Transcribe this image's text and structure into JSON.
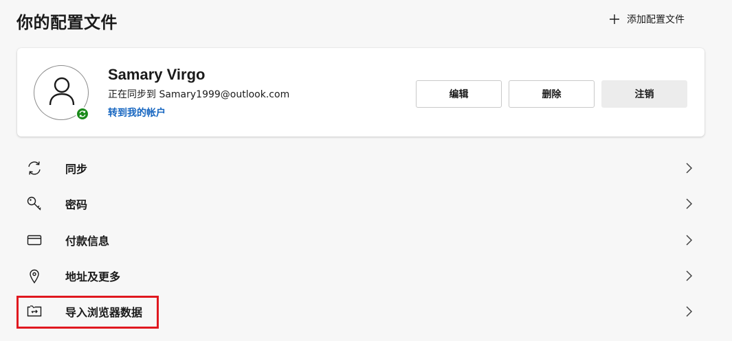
{
  "header": {
    "title": "你的配置文件",
    "add_profile_label": "添加配置文件"
  },
  "profile": {
    "name": "Samary Virgo",
    "sync_status": "正在同步到 Samary1999@outlook.com",
    "account_link": "转到我的帐户",
    "badge_color": "#1b8a1b",
    "buttons": {
      "edit": "编辑",
      "delete": "删除",
      "sign_out": "注销"
    }
  },
  "settings_list": [
    {
      "label": "同步",
      "icon": "sync-icon"
    },
    {
      "label": "密码",
      "icon": "key-icon"
    },
    {
      "label": "付款信息",
      "icon": "card-icon"
    },
    {
      "label": "地址及更多",
      "icon": "location-pin-icon"
    },
    {
      "label": "导入浏览器数据",
      "icon": "import-icon",
      "highlighted": true
    }
  ],
  "colors": {
    "link": "#1565c0",
    "highlight": "#e0181f",
    "background": "#f7f7f7"
  }
}
